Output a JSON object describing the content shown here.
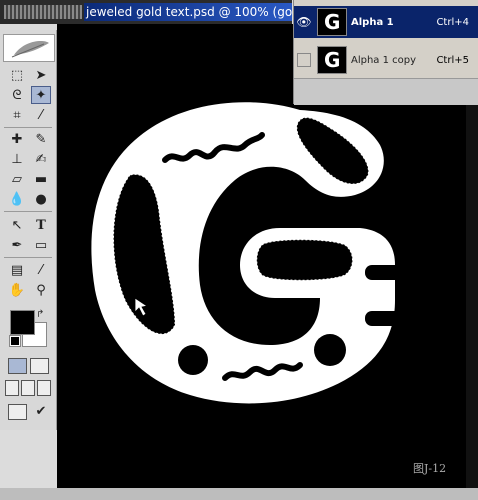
{
  "document": {
    "title": "jeweled gold text.psd @ 100% (gold text,"
  },
  "channels": [
    {
      "name": "Alpha 1",
      "shortcut": "Ctrl+4",
      "visible": true,
      "active": true
    },
    {
      "name": "Alpha 1 copy",
      "shortcut": "Ctrl+5",
      "visible": false,
      "active": false
    }
  ],
  "figure_label": "图J-12",
  "colors": {
    "foreground": "#000000",
    "background": "#ffffff",
    "selection": "#0a246a"
  },
  "tools": [
    "marquee-tool",
    "move-tool",
    "lasso-tool",
    "magic-wand-tool",
    "crop-tool",
    "slice-tool",
    "healing-brush-tool",
    "brush-tool",
    "clone-stamp-tool",
    "history-brush-tool",
    "eraser-tool",
    "gradient-tool",
    "blur-tool",
    "dodge-tool",
    "path-selection-tool",
    "type-tool",
    "pen-tool",
    "shape-tool",
    "notes-tool",
    "eyedropper-tool",
    "hand-tool",
    "zoom-tool"
  ]
}
